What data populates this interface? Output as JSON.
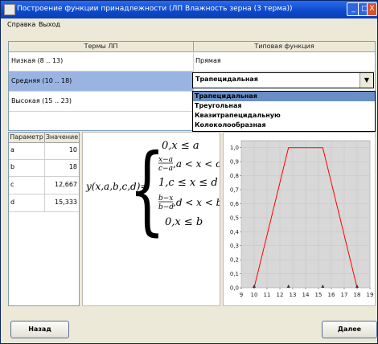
{
  "window": {
    "title": "Построение функции принадлежности (ЛП Влажность зерна (3 терма))",
    "minimize": "_",
    "maximize": "□",
    "close": "X"
  },
  "menu": {
    "items": [
      "Справка",
      "Выход"
    ]
  },
  "terms_table": {
    "headers": [
      "Термы ЛП",
      "Типовая функция"
    ],
    "rows": [
      {
        "term": "Низкая (8 .. 13)",
        "function": "Прямая"
      },
      {
        "term": "Средняя (10 .. 18)",
        "function": "Трапецидальная"
      },
      {
        "term": "Высокая (15 .. 23)",
        "function": ""
      }
    ]
  },
  "combo": {
    "value": "Трапецидальная",
    "options": [
      "Трапецидальная",
      "Треугольная",
      "Квазитрапецидальную",
      "Колоколообразная"
    ]
  },
  "params_table": {
    "headers": [
      "Параметр",
      "Значение"
    ],
    "rows": [
      {
        "name": "a",
        "value": "10"
      },
      {
        "name": "b",
        "value": "18"
      },
      {
        "name": "c",
        "value": "12,667"
      },
      {
        "name": "d",
        "value": "15,333"
      }
    ]
  },
  "formula": {
    "lhs": "y(x,a,b,c,d)=",
    "case1": "0,x ≤ a",
    "case2_num": "x−a",
    "case2_den": "c−a",
    "case2_cond": ",a < x < c",
    "case3": "1,c ≤ x ≤ d",
    "case4_num": "b−x",
    "case4_den": "b−d",
    "case4_cond": ",d < x < b",
    "case5": "0,x ≤ b"
  },
  "chart_data": {
    "type": "line",
    "x": [
      10,
      12.667,
      15.333,
      18
    ],
    "series": [
      {
        "values": [
          0,
          1,
          1,
          0
        ],
        "color": "#ff0000"
      }
    ],
    "x_ticks": [
      "9",
      "10",
      "11",
      "12",
      "13",
      "14",
      "15",
      "16",
      "17",
      "18",
      "19"
    ],
    "y_ticks": [
      "0,0",
      "0,1",
      "0,2",
      "0,3",
      "0,4",
      "0,5",
      "0,6",
      "0,7",
      "0,8",
      "0,9",
      "1,0"
    ],
    "xlim": [
      9,
      19
    ],
    "ylim": [
      0,
      1.05
    ],
    "grid": true,
    "background": "#d8d8d8",
    "markers": [
      10,
      12.667,
      15.333,
      18
    ]
  },
  "buttons": {
    "back": "Назад",
    "next": "Далее"
  },
  "colors": {
    "title_bar": "#0d48c8",
    "selection": "#6a8ec8",
    "line": "#ff0000"
  }
}
